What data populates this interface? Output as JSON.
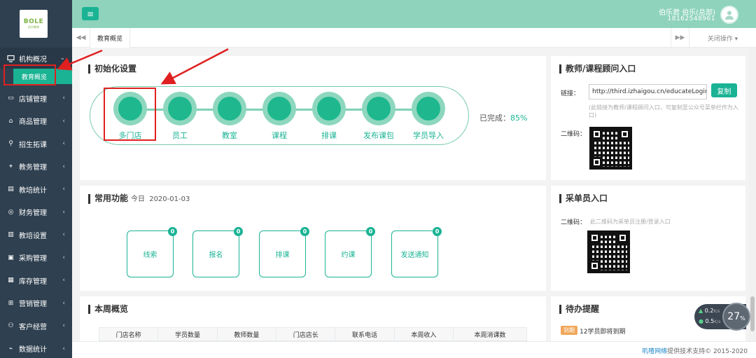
{
  "logo": {
    "text": "BOLE",
    "sub": "伯乐教育"
  },
  "sidebar": {
    "active": {
      "label": "机构概况",
      "sub_label": "教育概览"
    },
    "items": [
      {
        "label": "店铺管理"
      },
      {
        "label": "商品管理"
      },
      {
        "label": "招生拓课"
      },
      {
        "label": "教务管理"
      },
      {
        "label": "教培统计"
      },
      {
        "label": "财务管理"
      },
      {
        "label": "教培设置"
      },
      {
        "label": "采购管理"
      },
      {
        "label": "库存管理"
      },
      {
        "label": "营销管理"
      },
      {
        "label": "客户经营"
      },
      {
        "label": "数据统计"
      }
    ]
  },
  "header": {
    "menu_icon": "≡",
    "user_name": "伯乐君  伯乐(总部)",
    "phone": "18162548961"
  },
  "tabs": {
    "current": "教育概览",
    "close_all": "关闭操作 ▾",
    "nav_left": "◀◀",
    "nav_right": "▶▶"
  },
  "init": {
    "title": "初始化设置",
    "steps": [
      "多门店",
      "员工",
      "教室",
      "课程",
      "排课",
      "发布课包",
      "学员导入"
    ],
    "done_label": "已完成：",
    "done_pct": "85%",
    "progress": 0.85
  },
  "common": {
    "title": "常用功能",
    "date_prefix": "今日",
    "date": "2020-01-03",
    "cards": [
      {
        "label": "线索",
        "count": "0"
      },
      {
        "label": "报名",
        "count": "0"
      },
      {
        "label": "排课",
        "count": "0"
      },
      {
        "label": "约课",
        "count": "0"
      },
      {
        "label": "发送通知",
        "count": "0"
      }
    ]
  },
  "weekly": {
    "title": "本周概览",
    "columns": [
      "门店名称",
      "学员数量",
      "教师数量",
      "门店店长",
      "联系电话",
      "本周收入",
      "本周消课数"
    ]
  },
  "teacher_entry": {
    "title": "教师/课程顾问入口",
    "link_label": "链接：",
    "link_value": "http://third.izhaigou.cn/educateLogin?i",
    "copy_label": "复制",
    "hint": "(此链接为教师/课程顾问入口，可复制至公众号菜单栏作为入口)",
    "qr_label": "二维码："
  },
  "buyer_entry": {
    "title": "采单员入口",
    "qr_label": "二维码：",
    "hint": "此二维码为采单员注册/登录入口"
  },
  "todo": {
    "title": "待办提醒",
    "badge": "到期",
    "text": "12学员即将到期"
  },
  "speed": {
    "up": "0.2",
    "down": "0.5",
    "unit": "K/s",
    "cpu": "27",
    "cpu_unit": "%"
  },
  "footer": {
    "brand": "叽喳网络",
    "text": "提供技术支持© 2015-2020"
  },
  "colors": {
    "accent": "#1ab394",
    "sidebar": "#2f4050",
    "topbar": "#8fd3bd",
    "annotation": "#e02020"
  }
}
